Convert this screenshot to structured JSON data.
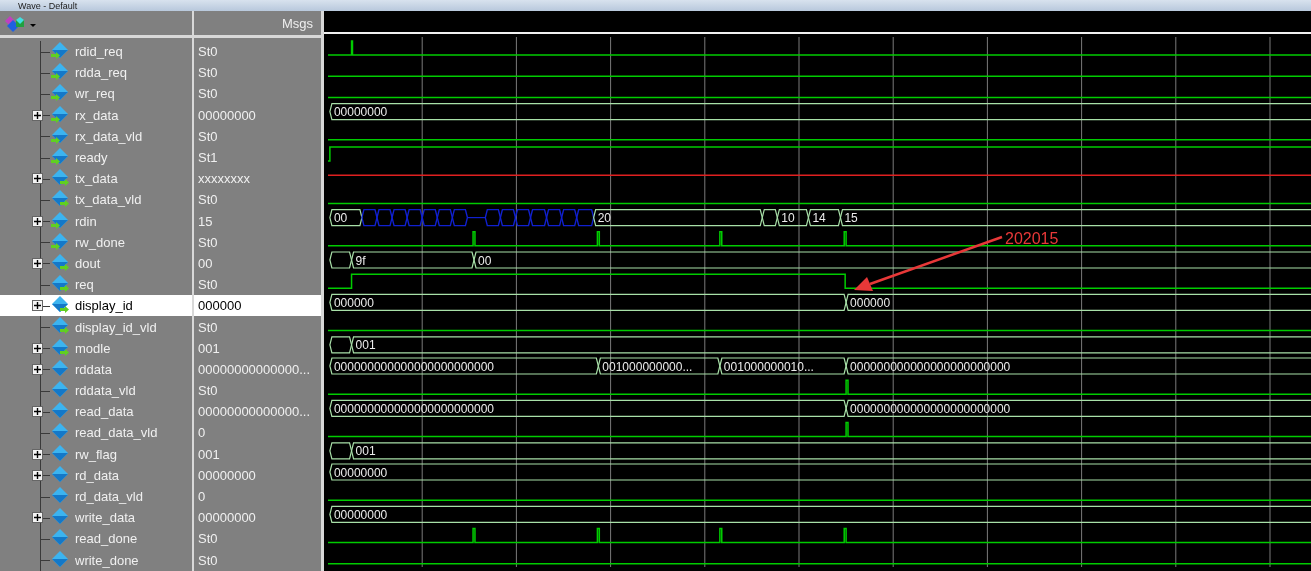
{
  "window": {
    "title": "Wave - Default"
  },
  "header": {
    "values_title": "Msgs"
  },
  "signals": [
    {
      "name": "rdid_req",
      "kind": "in",
      "value": "St0",
      "selected": false,
      "wave": {
        "kind": "bit"
      }
    },
    {
      "name": "rdda_req",
      "kind": "in",
      "value": "St0",
      "selected": false,
      "wave": {
        "kind": "bit"
      }
    },
    {
      "name": "wr_req",
      "kind": "in",
      "value": "St0",
      "selected": false,
      "wave": {
        "kind": "bit"
      }
    },
    {
      "name": "rx_data",
      "kind": "in",
      "value": "00000000",
      "selected": false,
      "expanded": false,
      "wave": {
        "kind": "bus",
        "segments": [
          {
            "kind": "valid",
            "label": "00000000"
          }
        ]
      }
    },
    {
      "name": "rx_data_vld",
      "kind": "in",
      "value": "St0",
      "selected": false,
      "wave": {
        "kind": "bit"
      }
    },
    {
      "name": "ready",
      "kind": "in",
      "value": "St1",
      "selected": false,
      "wave": {
        "kind": "bit"
      }
    },
    {
      "name": "tx_data",
      "kind": "out",
      "value": "xxxxxxxx",
      "selected": false,
      "expanded": false,
      "wave": {
        "kind": "unknown"
      }
    },
    {
      "name": "tx_data_vld",
      "kind": "out",
      "value": "St0",
      "selected": false,
      "wave": {
        "kind": "bit"
      }
    },
    {
      "name": "rdin",
      "kind": "in",
      "value": "15",
      "selected": false,
      "expanded": false,
      "wave": {
        "kind": "bus",
        "segments": [
          {
            "kind": "valid",
            "label": "00"
          },
          {
            "kind": "z"
          },
          {
            "kind": "z"
          },
          {
            "kind": "z"
          },
          {
            "kind": "z"
          },
          {
            "kind": "z"
          },
          {
            "kind": "z"
          },
          {
            "kind": "z"
          },
          {
            "kind": "float"
          },
          {
            "kind": "z"
          },
          {
            "kind": "z"
          },
          {
            "kind": "z"
          },
          {
            "kind": "z"
          },
          {
            "kind": "z"
          },
          {
            "kind": "z"
          },
          {
            "kind": "z"
          },
          {
            "kind": "valid",
            "label": "20"
          },
          {
            "kind": "valid"
          },
          {
            "kind": "valid",
            "label": "10"
          },
          {
            "kind": "valid",
            "label": "14"
          },
          {
            "kind": "valid",
            "label": "15"
          }
        ]
      }
    },
    {
      "name": "rw_done",
      "kind": "in",
      "value": "St0",
      "selected": false,
      "wave": {
        "kind": "bit"
      }
    },
    {
      "name": "dout",
      "kind": "out",
      "value": "00",
      "selected": false,
      "expanded": false,
      "wave": {
        "kind": "bus",
        "segments": [
          {
            "kind": "valid"
          },
          {
            "kind": "valid",
            "label": "9f"
          },
          {
            "kind": "valid",
            "label": "00"
          }
        ]
      }
    },
    {
      "name": "req",
      "kind": "out",
      "value": "St0",
      "selected": false,
      "wave": {
        "kind": "bit"
      }
    },
    {
      "name": "display_id",
      "kind": "out",
      "value": "000000",
      "selected": true,
      "expanded": false,
      "wave": {
        "kind": "bus",
        "segments": [
          {
            "kind": "valid",
            "label": "000000"
          },
          {
            "kind": "valid",
            "label": "000000"
          }
        ]
      }
    },
    {
      "name": "display_id_vld",
      "kind": "out",
      "value": "St0",
      "selected": false,
      "wave": {
        "kind": "bit"
      }
    },
    {
      "name": "modle",
      "kind": "out",
      "value": "001",
      "selected": false,
      "expanded": false,
      "wave": {
        "kind": "bus",
        "segments": [
          {
            "kind": "valid"
          },
          {
            "kind": "valid",
            "label": "001"
          }
        ]
      }
    },
    {
      "name": "rddata",
      "kind": "internal",
      "value": "00000000000000...",
      "selected": false,
      "expanded": false,
      "wave": {
        "kind": "bus",
        "segments": [
          {
            "kind": "valid",
            "label": "000000000000000000000000"
          },
          {
            "kind": "valid",
            "label": "001000000000..."
          },
          {
            "kind": "valid",
            "label": "001000000010..."
          },
          {
            "kind": "valid",
            "label": "000000000000000000000000"
          }
        ]
      }
    },
    {
      "name": "rddata_vld",
      "kind": "internal",
      "value": "St0",
      "selected": false,
      "wave": {
        "kind": "bit"
      }
    },
    {
      "name": "read_data",
      "kind": "internal",
      "value": "00000000000000...",
      "selected": false,
      "expanded": false,
      "wave": {
        "kind": "bus",
        "segments": [
          {
            "kind": "valid",
            "label": "000000000000000000000000"
          },
          {
            "kind": "valid",
            "label": "000000000000000000000000"
          }
        ]
      }
    },
    {
      "name": "read_data_vld",
      "kind": "internal",
      "value": "0",
      "selected": false,
      "wave": {
        "kind": "bit"
      }
    },
    {
      "name": "rw_flag",
      "kind": "internal",
      "value": "001",
      "selected": false,
      "expanded": false,
      "wave": {
        "kind": "bus",
        "segments": [
          {
            "kind": "valid"
          },
          {
            "kind": "valid",
            "label": "001"
          }
        ]
      }
    },
    {
      "name": "rd_data",
      "kind": "internal",
      "value": "00000000",
      "selected": false,
      "expanded": false,
      "wave": {
        "kind": "bus",
        "segments": [
          {
            "kind": "valid",
            "label": "00000000"
          }
        ]
      }
    },
    {
      "name": "rd_data_vld",
      "kind": "internal",
      "value": "0",
      "selected": false,
      "wave": {
        "kind": "bit"
      }
    },
    {
      "name": "write_data",
      "kind": "internal",
      "value": "00000000",
      "selected": false,
      "expanded": false,
      "wave": {
        "kind": "bus",
        "segments": [
          {
            "kind": "valid",
            "label": "00000000"
          }
        ]
      }
    },
    {
      "name": "read_done",
      "kind": "internal",
      "value": "St0",
      "selected": false,
      "wave": {
        "kind": "bit"
      }
    },
    {
      "name": "write_done",
      "kind": "internal",
      "value": "St0",
      "selected": false,
      "wave": {
        "kind": "bit"
      }
    }
  ],
  "annotation": {
    "text": "202015"
  }
}
